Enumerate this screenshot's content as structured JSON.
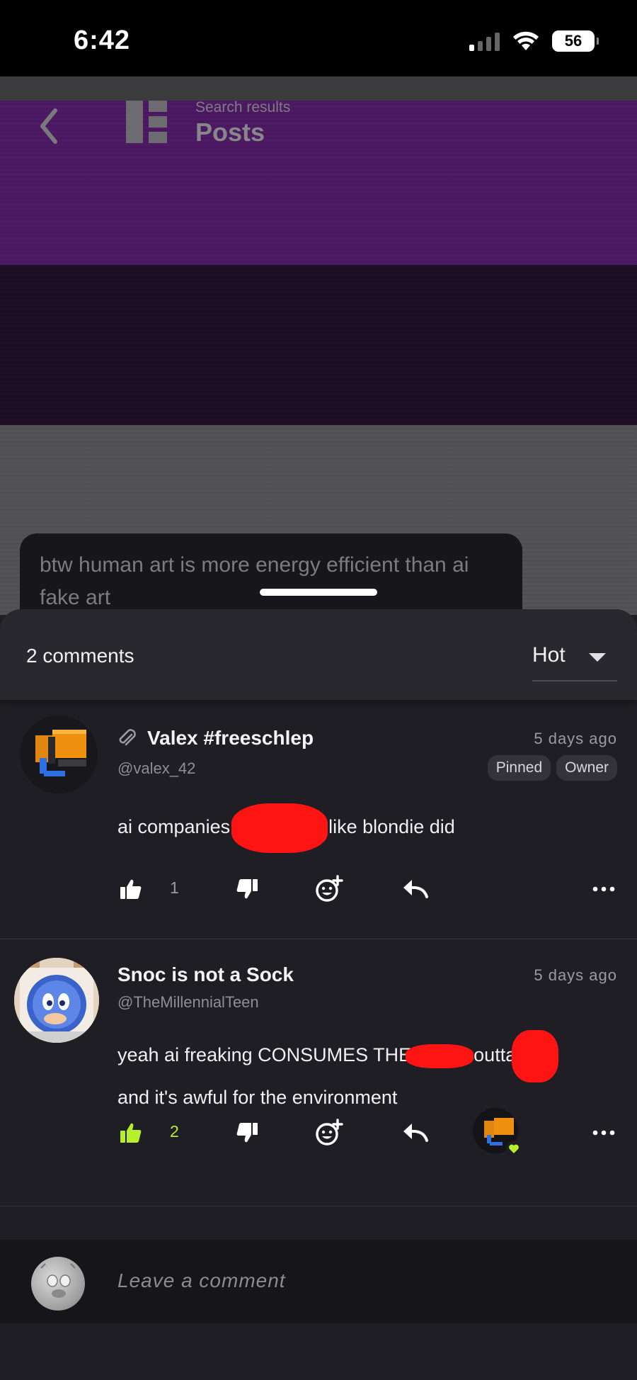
{
  "status_bar": {
    "time": "6:42",
    "battery": "56"
  },
  "background_page": {
    "subtitle": "Search results",
    "title": "Posts",
    "post_text": "btw human art is more energy efficient than ai fake art"
  },
  "sheet": {
    "comment_count": "2 comments",
    "sort": {
      "selected": "Hot"
    }
  },
  "comments": [
    {
      "author": "Valex #freeschlep",
      "handle": "@valex_42",
      "time": "5 days ago",
      "badges": [
        "Pinned",
        "Owner"
      ],
      "text_before": "ai companies",
      "text_after": "like blondie did",
      "like_count": "1",
      "liked": false
    },
    {
      "author": "Snoc is not a Sock",
      "handle": "@TheMillennialTeen",
      "time": "5 days ago",
      "text_line1_before": "yeah ai freaking CONSUMES THE",
      "text_line1_mid": "outta",
      "text_line2": "and it's awful for the environment",
      "like_count": "2",
      "liked": true
    }
  ],
  "compose": {
    "placeholder": "Leave a comment"
  },
  "colors": {
    "accent_like": "#b6ef2b",
    "sheet_bg": "#1f1e24",
    "redaction": "#ff1414"
  }
}
